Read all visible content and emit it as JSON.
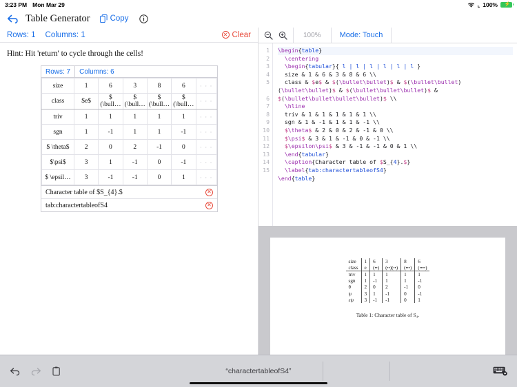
{
  "status_bar": {
    "time": "3:23 PM",
    "date": "Mon Mar 29",
    "wifi_icon": "wifi-icon",
    "location_icon": "location-arrow-icon",
    "battery_percent": "100%",
    "battery_icon": "battery-charging-icon"
  },
  "title_bar": {
    "back_icon": "back-arrow-icon",
    "title": "Table Generator",
    "copy_icon": "copy-icon",
    "copy_label": "Copy",
    "info_icon": "info-circle-icon"
  },
  "editor_toolbar": {
    "rows_label": "Rows: 1",
    "columns_label": "Columns: 1",
    "clear_label": "Clear",
    "clear_icon": "x-circle-icon"
  },
  "hint": "Hint: Hit 'return' to cycle through the cells!",
  "grid": {
    "rows_label": "Rows: 7",
    "columns_label": "Columns: 6",
    "overflow_cell": "· · ·",
    "rows": [
      {
        "cells": [
          "size",
          "1",
          "6",
          "3",
          "8",
          "6"
        ],
        "hline_after": false
      },
      {
        "cells": [
          "class",
          "$e$",
          "$ (\\bull…",
          "$ (\\bull…",
          "$ (\\bull…",
          "$ (\\bull…"
        ],
        "hline_after": true
      },
      {
        "cells": [
          "triv",
          "1",
          "1",
          "1",
          "1",
          "1"
        ],
        "hline_after": false
      },
      {
        "cells": [
          "sgn",
          "1",
          "-1",
          "1",
          "1",
          "-1"
        ],
        "hline_after": false
      },
      {
        "cells": [
          "$ \\theta$",
          "2",
          "0",
          "2",
          "-1",
          "0"
        ],
        "hline_after": false
      },
      {
        "cells": [
          "$\\psi$",
          "3",
          "1",
          "-1",
          "0",
          "-1"
        ],
        "hline_after": false
      },
      {
        "cells": [
          "$ \\epsil…",
          "3",
          "-1",
          "-1",
          "0",
          "1"
        ],
        "hline_after": false
      }
    ],
    "caption_field": "Character table of $S_{4}.$",
    "label_field": "tab:charactertableofS4",
    "remove_icon": "x-circle-icon"
  },
  "preview_toolbar": {
    "zoom_out_icon": "magnifier-minus-icon",
    "zoom_in_icon": "magnifier-plus-icon",
    "zoom_level": "100%",
    "mode_label": "Mode: Touch"
  },
  "code": {
    "lines": [
      {
        "n": "1",
        "text": "\\begin{table}"
      },
      {
        "n": "2",
        "text": "  \\centering"
      },
      {
        "n": "3",
        "text": "  \\begin{tabular}{ l | l | l | l | l | l }"
      },
      {
        "n": "4",
        "text": "  size & 1 & 6 & 3 & 8 & 6 \\\\"
      },
      {
        "n": "5",
        "text": "  class & $e$ & $(\\bullet\\bullet)$ & $(\\bullet\\bullet)(\\bullet\\bullet)$ & $(\\bullet\\bullet\\bullet)$ & $(\\bullet\\bullet\\bullet\\bullet)$ \\\\"
      },
      {
        "n": "6",
        "text": "  \\hline"
      },
      {
        "n": "7",
        "text": "  triv & 1 & 1 & 1 & 1 & 1 \\\\"
      },
      {
        "n": "8",
        "text": "  sgn & 1 & -1 & 1 & 1 & -1 \\\\"
      },
      {
        "n": "9",
        "text": "  $\\theta$ & 2 & 0 & 2 & -1 & 0 \\\\"
      },
      {
        "n": "10",
        "text": "  $\\psi$ & 3 & 1 & -1 & 0 & -1 \\\\"
      },
      {
        "n": "11",
        "text": "  $\\epsilon\\psi$ & 3 & -1 & -1 & 0 & 1 \\\\"
      },
      {
        "n": "12",
        "text": "  \\end{tabular}"
      },
      {
        "n": "13",
        "text": "  \\caption{Character table of $S_{4}.$}"
      },
      {
        "n": "14",
        "text": "  \\label{tab:charactertableofS4}"
      },
      {
        "n": "15",
        "text": "\\end{table}"
      }
    ]
  },
  "preview_table": {
    "header_rows": [
      {
        "cells": [
          "size",
          "1",
          "6",
          "3",
          "8",
          "6"
        ]
      },
      {
        "cells": [
          "class",
          "e",
          "(••)",
          "(••)(••)",
          "(•••)",
          "(••••)"
        ]
      }
    ],
    "body_rows": [
      {
        "cells": [
          "triv",
          "1",
          "1",
          "1",
          "1",
          "1"
        ]
      },
      {
        "cells": [
          "sgn",
          "1",
          "-1",
          "1",
          "1",
          "-1"
        ]
      },
      {
        "cells": [
          "θ",
          "2",
          "0",
          "2",
          "-1",
          "0"
        ]
      },
      {
        "cells": [
          "ψ",
          "3",
          "1",
          "-1",
          "0",
          "-1"
        ]
      },
      {
        "cells": [
          "εψ",
          "3",
          "-1",
          "-1",
          "0",
          "1"
        ]
      }
    ],
    "caption": "Table 1: Character table of S₄."
  },
  "bottom_bar": {
    "undo_icon": "undo-arrow-icon",
    "redo_icon": "redo-arrow-icon",
    "paste_icon": "clipboard-icon",
    "suggestion": "“charactertableofS4”",
    "keyboard_icon": "hide-keyboard-icon"
  },
  "colors": {
    "accent_blue": "#1a6fe8",
    "danger_red": "#e8493a",
    "latex_command": "#9b2fae",
    "latex_brace": "#1f4fd8",
    "preview_bg": "#c9c9cd"
  }
}
